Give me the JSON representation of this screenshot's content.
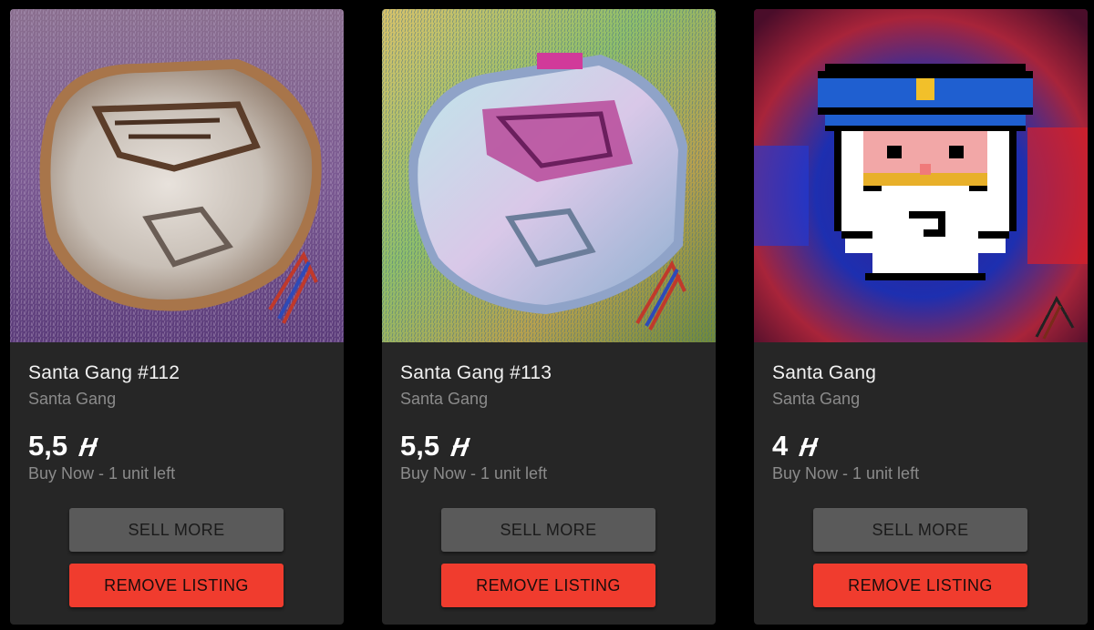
{
  "colors": {
    "page_bg": "#000000",
    "card_bg": "#262626",
    "sell_button": "#5a5a5a",
    "remove_button": "#f03c2e",
    "muted_text": "#8b8b8b"
  },
  "currency_icon": "alephium-logo-icon",
  "cards": [
    {
      "title": "Santa Gang #112",
      "collection": "Santa Gang",
      "price": "5,5",
      "availability": "Buy Now - 1 unit left",
      "sell_label": "SELL MORE",
      "remove_label": "REMOVE LISTING",
      "image_icon": "floating-island-nft-artwork"
    },
    {
      "title": "Santa Gang #113",
      "collection": "Santa Gang",
      "price": "5,5",
      "availability": "Buy Now - 1 unit left",
      "sell_label": "SELL MORE",
      "remove_label": "REMOVE LISTING",
      "image_icon": "psychedelic-island-nft-artwork"
    },
    {
      "title": "Santa Gang",
      "collection": "Santa Gang",
      "price": "4",
      "availability": "Buy Now - 1 unit left",
      "sell_label": "SELL MORE",
      "remove_label": "REMOVE LISTING",
      "image_icon": "pixel-santa-police-nft-artwork"
    }
  ]
}
